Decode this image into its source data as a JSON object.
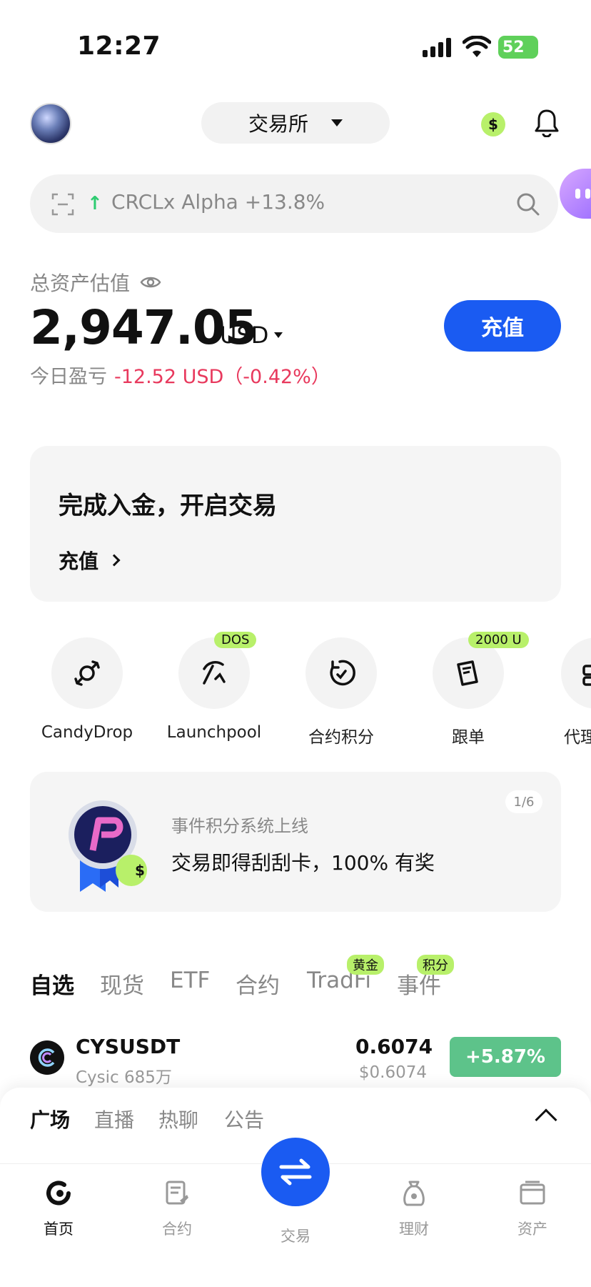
{
  "status": {
    "time": "12:27",
    "battery": "52"
  },
  "header": {
    "exchange_switcher": "交易所",
    "currency_badge": "$"
  },
  "search": {
    "arrow": "↑",
    "trending": "CRCLx Alpha +13.8%"
  },
  "assets": {
    "label": "总资产估值",
    "balance": "2,947.05",
    "currency": "USD",
    "pnl_label": "今日盈亏",
    "pnl_value": "-12.52 USD（-0.42%）",
    "deposit_button": "充值"
  },
  "promo_card": {
    "title": "完成入金，开启交易",
    "link": "充值"
  },
  "shortcuts": [
    {
      "label": "CandyDrop",
      "tag": ""
    },
    {
      "label": "Launchpool",
      "tag": "DOS"
    },
    {
      "label": "合约积分",
      "tag": ""
    },
    {
      "label": "跟单",
      "tag": "2000 U"
    },
    {
      "label": "代理"
    }
  ],
  "event_banner": {
    "subtitle": "事件积分系统上线",
    "title": "交易即得刮刮卡，100% 有奖",
    "pager": "1/6",
    "medal_badge": "$"
  },
  "market_tabs": [
    {
      "label": "自选",
      "tag": ""
    },
    {
      "label": "现货",
      "tag": ""
    },
    {
      "label": "ETF",
      "tag": ""
    },
    {
      "label": "合约",
      "tag": ""
    },
    {
      "label": "TradFi",
      "tag": "黄金"
    },
    {
      "label": "事件",
      "tag": "积分"
    }
  ],
  "market_rows": [
    {
      "symbol": "CYSUSDT",
      "name_volume": "Cysic 685万",
      "price": "0.6074",
      "price_usd": "$0.6074",
      "change": "+5.87%",
      "change_color": "#5dc38a"
    }
  ],
  "sheet_tabs": [
    "广场",
    "直播",
    "热聊",
    "公告"
  ],
  "bottom_nav": [
    "首页",
    "合约",
    "交易",
    "理财",
    "资产"
  ],
  "colors": {
    "accent": "#1a5bf2",
    "positive": "#5dc38a",
    "negative": "#e8395d",
    "tag_green": "#b8f06a"
  }
}
